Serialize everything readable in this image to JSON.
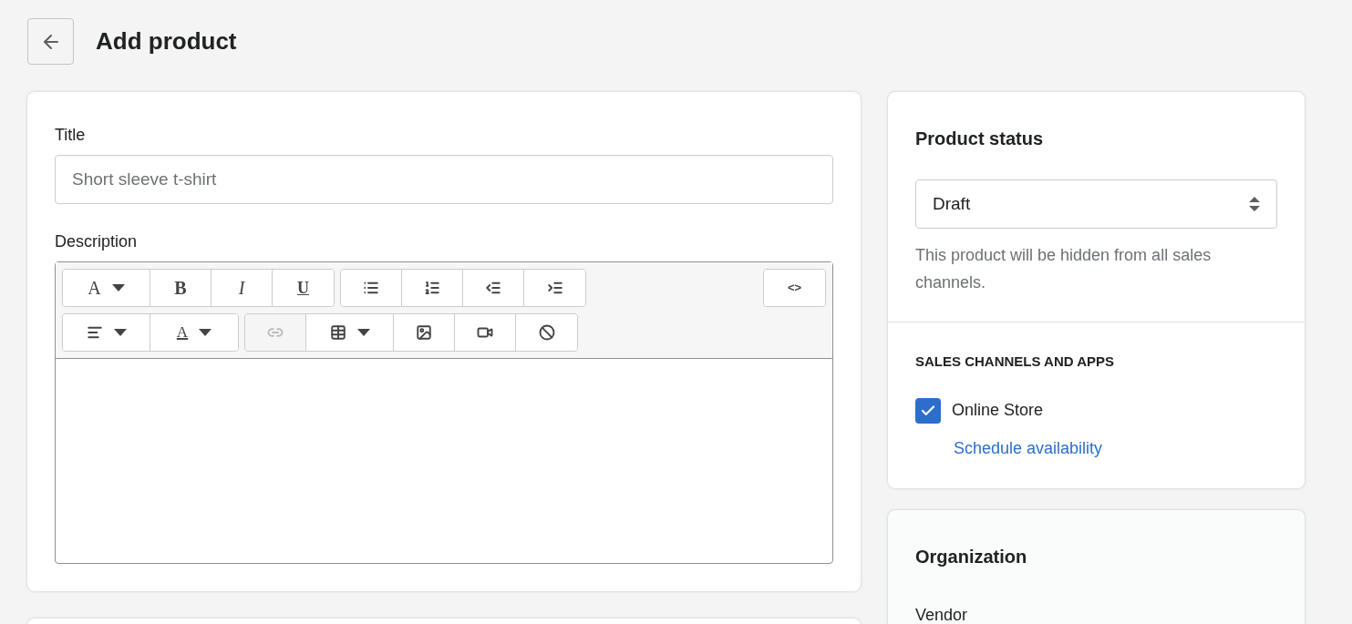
{
  "header": {
    "title": "Add product"
  },
  "product_card": {
    "title_label": "Title",
    "title_placeholder": "Short sleeve t-shirt",
    "description_label": "Description",
    "toolbar": [
      [
        [
          {
            "kind": "text",
            "label": "A",
            "disabled": false
          },
          {
            "kind": "text",
            "label": "B",
            "disabled": false
          },
          {
            "kind": "text",
            "label": "I",
            "disabled": false
          },
          {
            "kind": "text",
            "label": "U",
            "disabled": false
          }
        ],
        [
          {
            "kind": "icon",
            "disabled": false
          },
          {
            "kind": "icon",
            "disabled": false
          },
          {
            "kind": "icon",
            "disabled": false
          },
          {
            "kind": "icon",
            "disabled": false
          }
        ],
        [
          {
            "kind": "text",
            "label": "<>",
            "disabled": false
          }
        ]
      ],
      [
        [
          {
            "kind": "icon",
            "disabled": false
          },
          {
            "kind": "text",
            "label": "A",
            "disabled": false
          }
        ],
        [
          {
            "kind": "icon",
            "disabled": true
          },
          {
            "kind": "icon",
            "disabled": false
          },
          {
            "kind": "icon",
            "disabled": false
          },
          {
            "kind": "icon",
            "disabled": false
          },
          {
            "kind": "icon",
            "disabled": false
          }
        ]
      ]
    ]
  },
  "status_card": {
    "heading": "Product status",
    "status_value": "Draft",
    "hint": "This product will be hidden from all sales channels.",
    "channels_heading": "SALES CHANNELS AND APPS",
    "channels": [
      {
        "name": "Online Store",
        "checked": true,
        "link": "Schedule availability"
      }
    ]
  },
  "organization_card": {
    "heading": "Organization",
    "vendor_label": "Vendor"
  }
}
